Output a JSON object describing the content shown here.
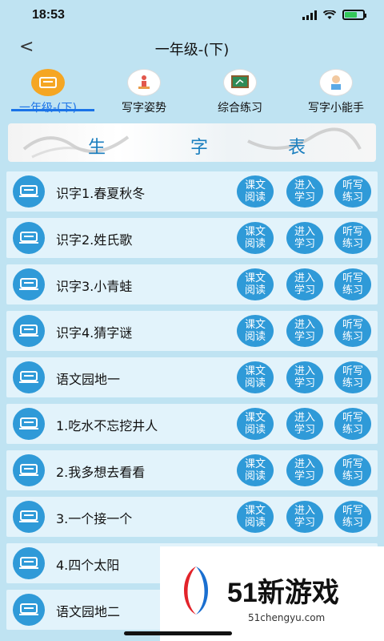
{
  "status": {
    "time": "18:53"
  },
  "nav": {
    "back": "<",
    "title": "一年级-(下)"
  },
  "tabs": [
    {
      "label": "一年级-(下)",
      "icon": "book-icon"
    },
    {
      "label": "写字姿势",
      "icon": "writing-posture-icon"
    },
    {
      "label": "综合练习",
      "icon": "blackboard-icon"
    },
    {
      "label": "写字小能手",
      "icon": "writer-icon"
    }
  ],
  "banner": {
    "chars": [
      "生",
      "字",
      "表"
    ]
  },
  "buttons": {
    "read": [
      "课文",
      "阅读"
    ],
    "learn": [
      "进入",
      "学习"
    ],
    "dictate": [
      "听写",
      "练习"
    ]
  },
  "lessons": [
    "识字1.春夏秋冬",
    "识字2.姓氏歌",
    "识字3.小青蛙",
    "识字4.猜字谜",
    "语文园地一",
    "1.吃水不忘挖井人",
    "2.我多想去看看",
    "3.一个接一个",
    "4.四个太阳",
    "语文园地二"
  ],
  "watermark": {
    "brand": "51新游戏",
    "url": "51chengyu.com"
  },
  "colors": {
    "accent": "#2f9ad8",
    "active_tab": "#f5a623",
    "background": "#bfe3f2"
  }
}
